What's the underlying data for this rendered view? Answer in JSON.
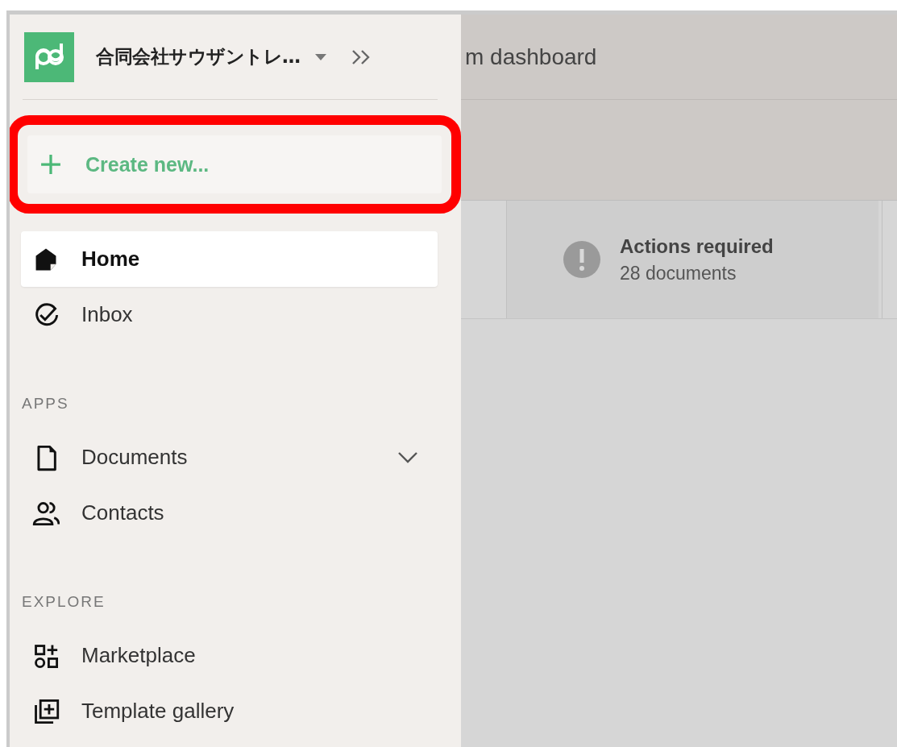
{
  "sidebar": {
    "org_name": "合同会社サウザントレ…",
    "create_button": {
      "label": "Create new...",
      "highlighted": true
    },
    "nav": [
      {
        "kind": "home",
        "label": "Home",
        "selected": true
      },
      {
        "kind": "inbox",
        "label": "Inbox",
        "selected": false
      }
    ],
    "sections": [
      {
        "title": "APPS",
        "items": [
          {
            "kind": "documents",
            "label": "Documents",
            "expanded": false
          },
          {
            "kind": "contacts",
            "label": "Contacts"
          }
        ]
      },
      {
        "title": "EXPLORE",
        "items": [
          {
            "kind": "marketplace",
            "label": "Marketplace"
          },
          {
            "kind": "templates",
            "label": "Template gallery"
          }
        ]
      }
    ]
  },
  "main": {
    "title": "m dashboard",
    "stat_cards": [
      {
        "kind": "alert",
        "title": "Actions required",
        "subtitle": "28 documents"
      }
    ]
  }
}
